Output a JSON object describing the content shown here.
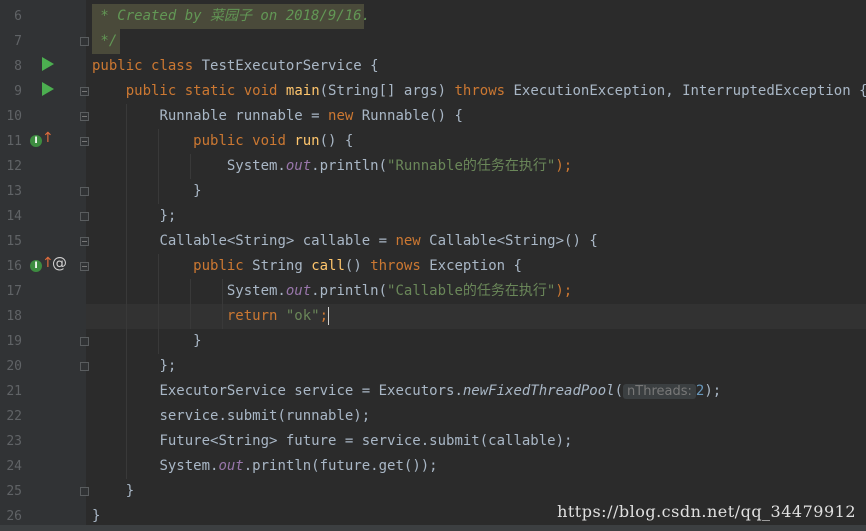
{
  "editor": {
    "line_numbers": [
      "6",
      "7",
      "8",
      "9",
      "10",
      "11",
      "12",
      "13",
      "14",
      "15",
      "16",
      "17",
      "18",
      "19",
      "20",
      "21",
      "22",
      "23",
      "24",
      "25",
      "26"
    ],
    "lines": {
      "l6": {
        "comment": " * Created by 菜园子 on 2018/9/16."
      },
      "l7": {
        "comment": " */"
      },
      "l8": {
        "kw1": "public ",
        "kw2": "class ",
        "name": "TestExecutorService",
        "rest": " {"
      },
      "l9": {
        "indent": "    ",
        "kw1": "public ",
        "kw2": "static ",
        "kw3": "void ",
        "fn": "main",
        "p1": "(String[] args) ",
        "kw4": "throws ",
        "p2": "ExecutionException, InterruptedException {"
      },
      "l10": {
        "indent": "        ",
        "p1": "Runnable runnable = ",
        "kw1": "new ",
        "p2": "Runnable() {"
      },
      "l11": {
        "indent": "            ",
        "kw1": "public ",
        "kw2": "void ",
        "fn": "run",
        "p1": "() {"
      },
      "l12": {
        "indent": "                ",
        "p1": "System.",
        "field": "out",
        "p2": ".println(",
        "str": "\"Runnable的任务在执行\"",
        "p3": ");"
      },
      "l13": {
        "indent": "            ",
        "p1": "}"
      },
      "l14": {
        "indent": "        ",
        "p1": "};"
      },
      "l15": {
        "indent": "        ",
        "p1": "Callable<String> callable = ",
        "kw1": "new ",
        "p2": "Callable<String>() {"
      },
      "l16": {
        "indent": "            ",
        "kw1": "public ",
        "p1": "String ",
        "fn": "call",
        "p2": "() ",
        "kw2": "throws ",
        "p3": "Exception {"
      },
      "l17": {
        "indent": "                ",
        "p1": "System.",
        "field": "out",
        "p2": ".println(",
        "str": "\"Callable的任务在执行\"",
        "p3": ");"
      },
      "l18": {
        "indent": "                ",
        "kw1": "return ",
        "str": "\"ok\"",
        "p1": ";"
      },
      "l19": {
        "indent": "            ",
        "p1": "}"
      },
      "l20": {
        "indent": "        ",
        "p1": "};"
      },
      "l21": {
        "indent": "        ",
        "p1": "ExecutorService service = Executors.",
        "static": "newFixedThreadPool",
        "p2": "(",
        "hint": "nThreads:",
        "num": "2",
        "p3": ");"
      },
      "l22": {
        "indent": "        ",
        "p1": "service.submit(runnable);"
      },
      "l23": {
        "indent": "        ",
        "p1": "Future<String> future = service.submit(callable);"
      },
      "l24": {
        "indent": "        ",
        "p1": "System.",
        "field": "out",
        "p2": ".println(future.get());"
      },
      "l25": {
        "indent": "    ",
        "p1": "}"
      },
      "l26": {
        "indent": "",
        "p1": "}"
      }
    }
  },
  "watermark": "https://blog.csdn.net/qq_34479912",
  "icons": {
    "run": "run-arrow-icon",
    "implements": "implements-icon",
    "annotation": "at-icon"
  },
  "colors": {
    "background": "#2b2b2b",
    "keyword": "#cc7832",
    "string": "#6a8759",
    "function": "#ffc66d",
    "field": "#9876aa",
    "comment": "#629755"
  }
}
